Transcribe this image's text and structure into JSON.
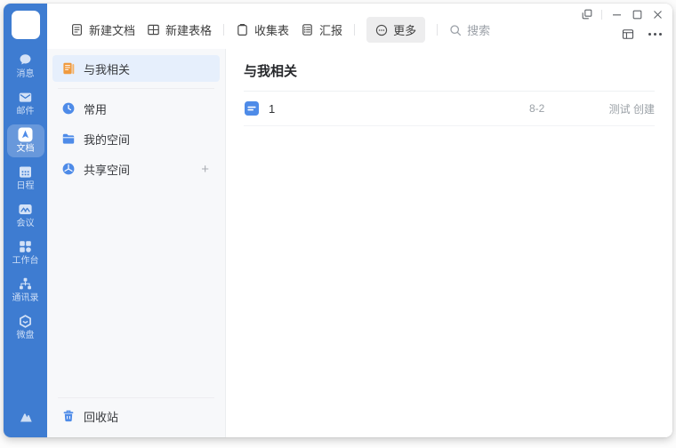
{
  "titlebar": {
    "controls": [
      "popout",
      "minimize",
      "maximize",
      "close"
    ],
    "secondary_controls": [
      "layout-toggle",
      "more"
    ]
  },
  "toolbar": {
    "buttons": [
      {
        "label": "新建文档",
        "icon": "new-doc-icon"
      },
      {
        "label": "新建表格",
        "icon": "new-sheet-icon"
      },
      {
        "label": "收集表",
        "icon": "collect-form-icon"
      },
      {
        "label": "汇报",
        "icon": "report-icon"
      },
      {
        "label": "更多",
        "icon": "more-circle-icon"
      }
    ],
    "search": {
      "placeholder": "搜索",
      "icon": "search-icon"
    }
  },
  "rail": {
    "items": [
      {
        "label": "消息",
        "icon": "chat-icon"
      },
      {
        "label": "邮件",
        "icon": "mail-icon"
      },
      {
        "label": "文档",
        "icon": "docs-icon",
        "selected": true
      },
      {
        "label": "日程",
        "icon": "calendar-icon"
      },
      {
        "label": "会议",
        "icon": "meeting-icon"
      },
      {
        "label": "工作台",
        "icon": "workbench-icon"
      },
      {
        "label": "通讯录",
        "icon": "contacts-icon"
      },
      {
        "label": "微盘",
        "icon": "drive-icon"
      }
    ],
    "bottom_icon": "logo-mark-icon"
  },
  "sidebar": {
    "items": [
      {
        "label": "与我相关",
        "icon": "related-doc-icon",
        "selected": true
      },
      {
        "label": "常用",
        "icon": "clock-icon"
      },
      {
        "label": "我的空间",
        "icon": "folder-icon"
      },
      {
        "label": "共享空间",
        "icon": "shared-space-icon",
        "action": "+"
      }
    ],
    "recycle": {
      "label": "回收站",
      "icon": "trash-icon"
    }
  },
  "main": {
    "title": "与我相关",
    "rows": [
      {
        "title": "1",
        "date": "8-2",
        "creator": "测试 创建",
        "icon": "doc-file-icon"
      }
    ]
  },
  "colors": {
    "rail_blue": "#3e7cd1",
    "accent_blue": "#4e8be8",
    "selected_item_bg": "#e6effc",
    "orange_icon": "#f09a3e",
    "muted_text": "#9aa0a6"
  }
}
